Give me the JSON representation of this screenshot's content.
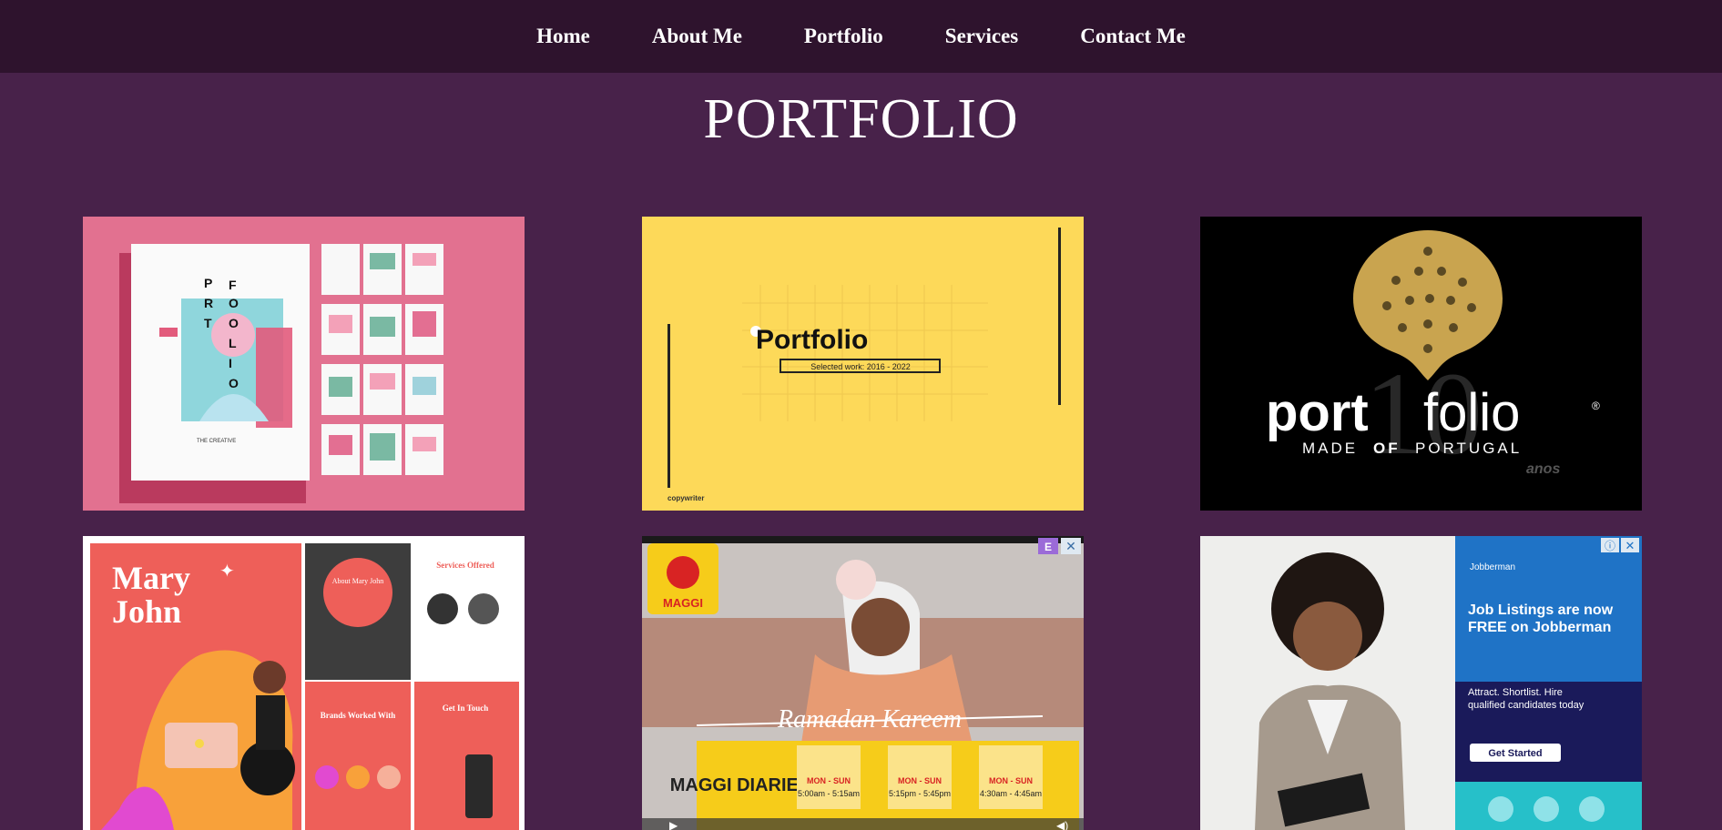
{
  "nav": {
    "items": [
      {
        "label": "Home"
      },
      {
        "label": "About Me"
      },
      {
        "label": "Portfolio"
      },
      {
        "label": "Services"
      },
      {
        "label": "Contact Me"
      }
    ]
  },
  "page": {
    "title": "PORTFOLIO"
  },
  "colors": {
    "page_bg": "#48224a",
    "nav_bg": "#2e132d",
    "text": "#ffffff"
  },
  "portfolio": {
    "items": [
      {
        "letters": [
          "P",
          "O",
          "R",
          "T",
          "F",
          "O",
          "L",
          "I",
          "O"
        ],
        "caption": "THE CREATIVE",
        "icon": "magazine-mockup-image"
      },
      {
        "title": "Portfolio",
        "subtitle": "Selected work: 2016 - 2022",
        "footer": "copywriter",
        "icon": "yellow-portfolio-cover-image"
      },
      {
        "word_bold": "port",
        "word_light": "folio",
        "registered": "®",
        "tagline_a": "MADE",
        "tagline_of": "OF",
        "tagline_b": "PORTUGAL",
        "big_number": "10",
        "anos": "anos",
        "icon": "portugal-heart-logo-image"
      },
      {
        "name_line1": "Mary",
        "name_line2": "John",
        "about": "About Mary John",
        "services": "Services Offered",
        "brands": "Brands Worked With",
        "contact": "Get In Touch",
        "icon": "mary-john-portfolio-image"
      },
      {
        "brand": "MAGGI",
        "script": "Ramadan Kareem",
        "diaries": "MAGGI DIARIES",
        "schedule": [
          {
            "days": "MON - SUN",
            "time": "5:00am - 5:15am"
          },
          {
            "days": "MON - SUN",
            "time": "5:15pm - 5:45pm"
          },
          {
            "days": "MON - SUN",
            "time": "4:30am - 4:45am"
          }
        ],
        "icon": "maggi-ad-image"
      },
      {
        "brand": "Jobberman",
        "headline": "Job Listings are now FREE on Jobberman",
        "body": "Attract. Shortlist. Hire qualified candidates today",
        "cta": "Get Started",
        "icon": "jobberman-ad-image"
      }
    ]
  }
}
